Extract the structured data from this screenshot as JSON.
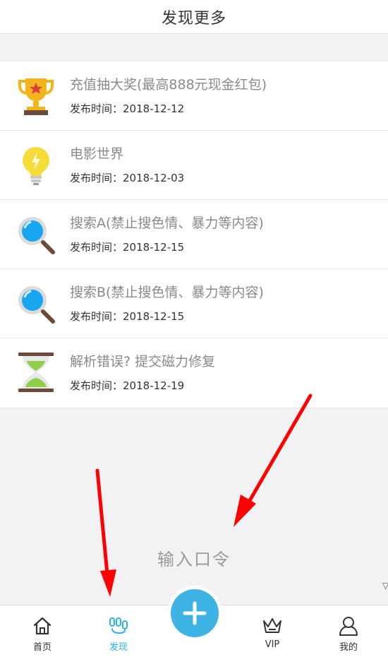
{
  "header": {
    "title": "发现更多"
  },
  "items": [
    {
      "title": "充值抽大奖(最高888元现金红包)",
      "meta_label": "发布时间：",
      "date": "2018-12-12",
      "icon": "trophy-icon"
    },
    {
      "title": "电影世界",
      "meta_label": "发布时间：",
      "date": "2018-12-03",
      "icon": "lightbulb-icon"
    },
    {
      "title": "搜索A(禁止搜色情、暴力等内容)",
      "meta_label": "发布时间：",
      "date": "2018-12-15",
      "icon": "magnifier-icon"
    },
    {
      "title": "搜索B(禁止搜色情、暴力等内容)",
      "meta_label": "发布时间：",
      "date": "2018-12-15",
      "icon": "magnifier-icon"
    },
    {
      "title": "解析错误? 提交磁力修复",
      "meta_label": "发布时间：",
      "date": "2018-12-19",
      "icon": "hourglass-icon"
    }
  ],
  "passcode": {
    "label": "输入口令"
  },
  "tabbar": {
    "tabs": [
      {
        "label": "首页",
        "icon": "home-icon"
      },
      {
        "label": "发现",
        "icon": "discover-icon",
        "active": true
      },
      {
        "label": "VIP",
        "icon": "crown-icon"
      },
      {
        "label": "我的",
        "icon": "user-icon"
      }
    ],
    "fab_icon": "plus-icon"
  },
  "colors": {
    "accent": "#3fb3e3",
    "active_tab": "#2fb0e0",
    "annotation_arrow": "#ff0000",
    "background": "#f2f2f4"
  }
}
